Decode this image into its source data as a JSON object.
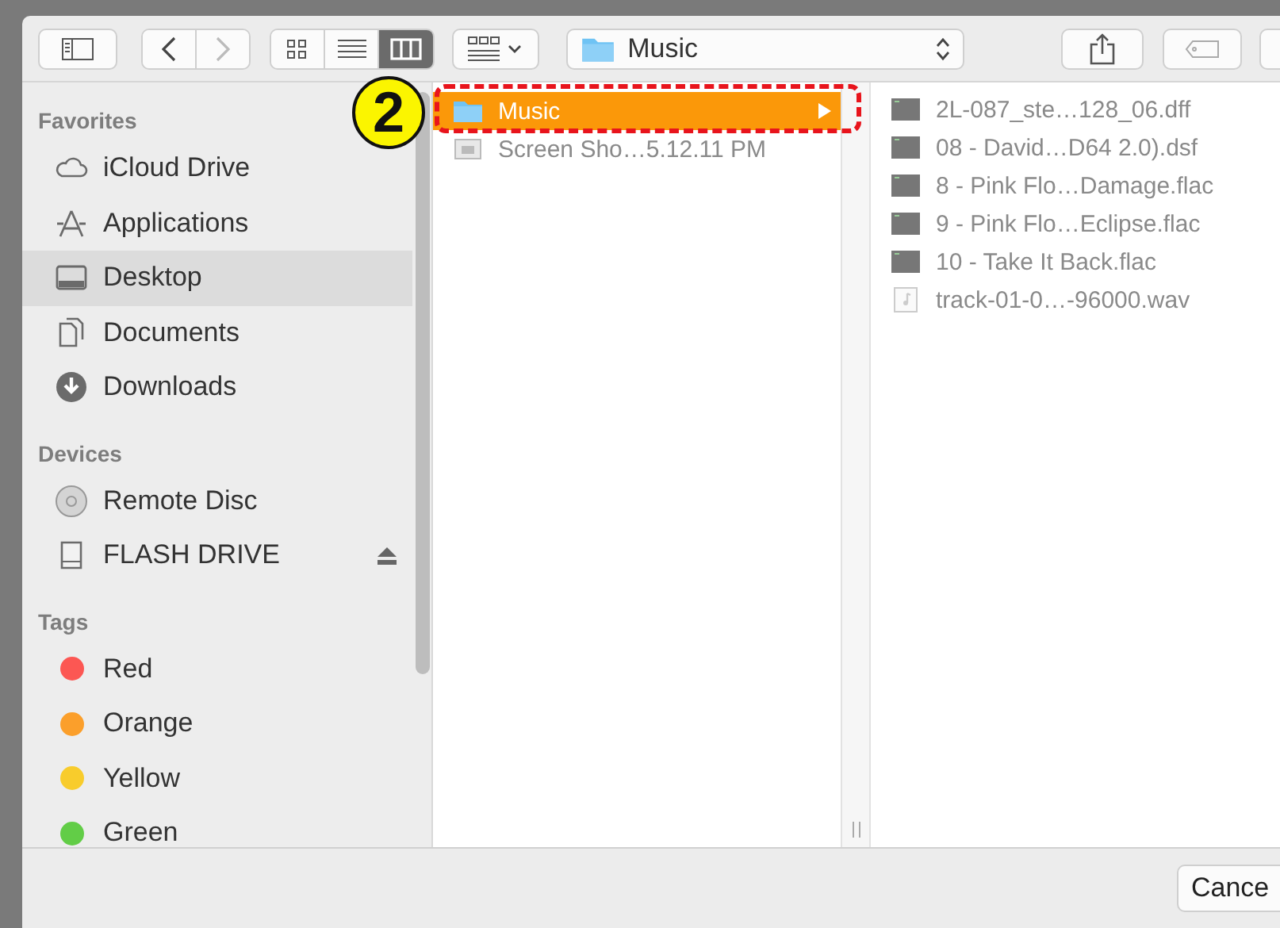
{
  "toolbar": {
    "view_modes": [
      {
        "kind": "icons",
        "selected": false
      },
      {
        "kind": "list",
        "selected": false
      },
      {
        "kind": "columns",
        "selected": true
      }
    ],
    "path": "Music"
  },
  "sidebar": {
    "sections": [
      {
        "title": "Favorites",
        "items": [
          {
            "label": "iCloud Drive",
            "kind": "cloud",
            "selected": false
          },
          {
            "label": "Applications",
            "kind": "apps",
            "selected": false
          },
          {
            "label": "Desktop",
            "kind": "desktop",
            "selected": true
          },
          {
            "label": "Documents",
            "kind": "documents",
            "selected": false
          },
          {
            "label": "Downloads",
            "kind": "downloads",
            "selected": false
          }
        ]
      },
      {
        "title": "Devices",
        "items": [
          {
            "label": "Remote Disc",
            "kind": "disc",
            "selected": false,
            "eject": false
          },
          {
            "label": "FLASH DRIVE",
            "kind": "drive",
            "selected": false,
            "eject": true
          }
        ]
      },
      {
        "title": "Tags",
        "items": [
          {
            "label": "Red",
            "kind": "tag",
            "selected": false,
            "color": "#fc5753"
          },
          {
            "label": "Orange",
            "kind": "tag",
            "selected": false,
            "color": "#fb9f2b"
          },
          {
            "label": "Yellow",
            "kind": "tag",
            "selected": false,
            "color": "#f8cc2c"
          },
          {
            "label": "Green",
            "kind": "tag",
            "selected": false,
            "color": "#62cd47"
          }
        ]
      }
    ]
  },
  "columns": [
    {
      "items": [
        {
          "label": "Music",
          "kind": "folder",
          "selected": true,
          "disabled": false
        },
        {
          "label": "Screen Sho…5.12.11 PM",
          "kind": "image",
          "selected": false,
          "disabled": true
        }
      ]
    },
    {
      "items": [
        {
          "label": "2L-087_ste…128_06.dff",
          "kind": "audio",
          "selected": false,
          "disabled": true
        },
        {
          "label": "08 - David…D64 2.0).dsf",
          "kind": "audio",
          "selected": false,
          "disabled": true
        },
        {
          "label": "8 - Pink Flo…Damage.flac",
          "kind": "audio",
          "selected": false,
          "disabled": true
        },
        {
          "label": "9 - Pink Flo…Eclipse.flac",
          "kind": "audio",
          "selected": false,
          "disabled": true
        },
        {
          "label": "10 - Take It Back.flac",
          "kind": "audio",
          "selected": false,
          "disabled": true
        },
        {
          "label": "track-01-0…-96000.wav",
          "kind": "wav",
          "selected": false,
          "disabled": true
        }
      ]
    }
  ],
  "annotation": {
    "step": "2"
  },
  "footer": {
    "cancel": "Cance"
  }
}
